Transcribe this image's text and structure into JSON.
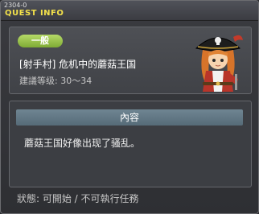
{
  "window": {
    "quest_id": "2304-0",
    "title": "QUEST INFO"
  },
  "quest": {
    "category_badge": "一般",
    "name": "[射手村] 危机中的蘑菇王国",
    "level_range": "建議等级: 30～34"
  },
  "content": {
    "header": "內容",
    "description": "蘑菇王国好像出现了骚乱。"
  },
  "status": {
    "text": "狀態: 可開始 / 不可執行任務"
  },
  "colors": {
    "title_text": "#f3e14a",
    "badge_green": "#8dbb3c",
    "content_header": "#5f7684"
  },
  "icons": {
    "npc": "pirate-captain-portrait"
  }
}
